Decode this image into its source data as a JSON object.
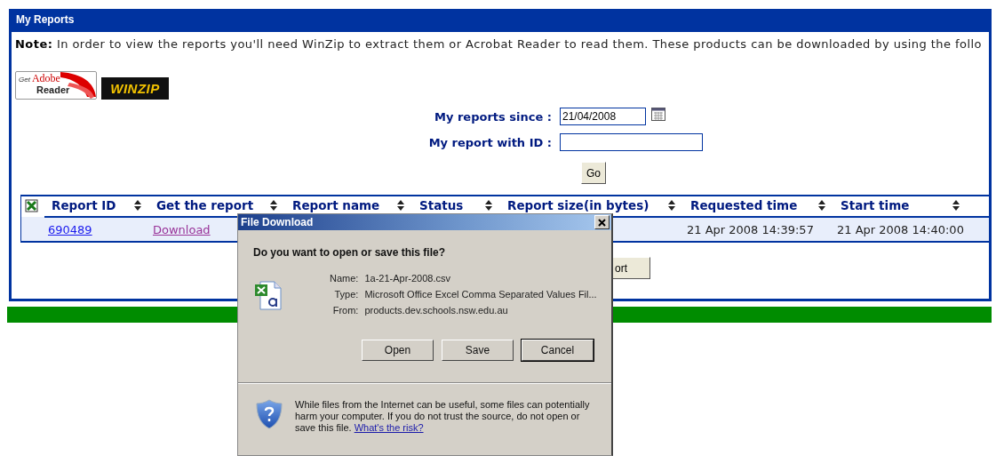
{
  "panel": {
    "title": "My Reports",
    "note": "**Note:** In order to view the reports you'll need WinZip to extract them or Acrobat Reader to read them. These products can be downloaded by using the follo",
    "logos": [
      {
        "kind": "adobe",
        "texts": [
          "Get",
          "Adobe",
          "Reader"
        ]
      },
      {
        "kind": "winzip",
        "texts": [
          "WINZIP"
        ]
      }
    ]
  },
  "filters": [
    {
      "label": "My reports since :",
      "value": "21/04/2008",
      "calendar": true
    },
    {
      "label": "My report with ID :",
      "calendar": false
    }
  ],
  "go_button": "Go",
  "table": {
    "columns": [
      "Report ID",
      "Get the report",
      "Report name",
      "Status",
      "Report size(in bytes)",
      "Requested time",
      "Start time"
    ],
    "rows": [
      {
        "cells": [
          "690489",
          "Download",
          null,
          null,
          null,
          "21 Apr 2008 14:39:57",
          "21 Apr 2008 14:40:00"
        ]
      }
    ]
  },
  "export_button": "ort",
  "dialog": {
    "title": "File Download",
    "question": "Do you want to open or save this file?",
    "fields": [
      {
        "label": "Name:",
        "value": "1a-21-Apr-2008.csv"
      },
      {
        "label": "Type:",
        "value": "Microsoft Office Excel Comma Separated Values Fil..."
      },
      {
        "label": "From:",
        "value": "products.dev.schools.nsw.edu.au"
      }
    ],
    "buttons": [
      {
        "label": "Open",
        "default": false
      },
      {
        "label": "Save",
        "default": false
      },
      {
        "label": "Cancel",
        "default": true
      }
    ],
    "warning": "While files from the Internet can be useful, some files can potentially harm your computer. If you do not trust the source, do not open or save this file.",
    "risk_link": "What's the risk?"
  }
}
